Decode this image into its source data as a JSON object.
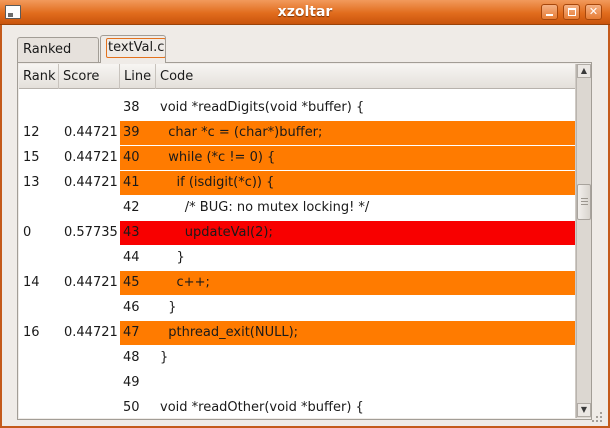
{
  "window": {
    "title": "xzoltar",
    "minimize_icon": "minimize-icon",
    "maximize_icon": "maximize-icon",
    "close_icon": "close-icon",
    "close_glyph": "✕"
  },
  "tabs": [
    {
      "label": "Ranked List",
      "active": false
    },
    {
      "label": "textVal.c",
      "active": true
    }
  ],
  "table": {
    "columns": [
      "Rank",
      "Score",
      "Line",
      "Code"
    ],
    "rows": [
      {
        "rank": "",
        "score": "",
        "line": "38",
        "code": "void *readDigits(void *buffer) {",
        "highlight": "none"
      },
      {
        "rank": "12",
        "score": "0.44721",
        "line": "39",
        "code": "  char *c = (char*)buffer;",
        "highlight": "orange"
      },
      {
        "rank": "15",
        "score": "0.44721",
        "line": "40",
        "code": "  while (*c != 0) {",
        "highlight": "orange"
      },
      {
        "rank": "13",
        "score": "0.44721",
        "line": "41",
        "code": "    if (isdigit(*c)) {",
        "highlight": "orange"
      },
      {
        "rank": "",
        "score": "",
        "line": "42",
        "code": "      /* BUG: no mutex locking! */",
        "highlight": "none"
      },
      {
        "rank": "0",
        "score": "0.57735",
        "line": "43",
        "code": "      updateVal(2);",
        "highlight": "red"
      },
      {
        "rank": "",
        "score": "",
        "line": "44",
        "code": "    }",
        "highlight": "none"
      },
      {
        "rank": "14",
        "score": "0.44721",
        "line": "45",
        "code": "    c++;",
        "highlight": "orange"
      },
      {
        "rank": "",
        "score": "",
        "line": "46",
        "code": "  }",
        "highlight": "none"
      },
      {
        "rank": "16",
        "score": "0.44721",
        "line": "47",
        "code": "  pthread_exit(NULL);",
        "highlight": "orange"
      },
      {
        "rank": "",
        "score": "",
        "line": "48",
        "code": "}",
        "highlight": "none"
      },
      {
        "rank": "",
        "score": "",
        "line": "49",
        "code": "",
        "highlight": "none"
      },
      {
        "rank": "",
        "score": "",
        "line": "50",
        "code": "void *readOther(void *buffer) {",
        "highlight": "none"
      }
    ]
  },
  "colors": {
    "titlebar": "#e16c1d",
    "highlight_orange": "#ff7b00",
    "highlight_red": "#f80000"
  }
}
